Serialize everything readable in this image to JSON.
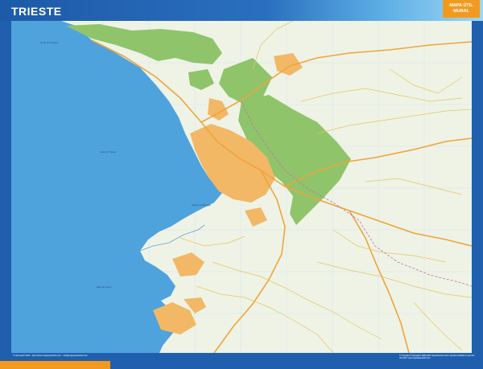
{
  "header": {
    "title": "TRIESTE",
    "badge_line1": "MAPA ÚTIL",
    "badge_line2": "MURAL"
  },
  "map": {
    "sea_labels": [
      "Golfo di Panzano",
      "Golfo di Trieste",
      "Vallone di Muggia",
      "Baia di Pirano"
    ],
    "colors": {
      "sea": "#4fa3dc",
      "land": "#eef3e6",
      "forest": "#8fc46b",
      "urban": "#f2b866",
      "road_major": "#f0a43a",
      "road_minor": "#e6c65a",
      "border": "#c06fa8",
      "frame": "#1f5fae",
      "accent": "#f39a1e"
    }
  },
  "footer": {
    "left_text": "© Netmaps® 2024 · http://www.mapasparatodo.com · info@mapasparatodo.com",
    "right_text": "© Copyright ® Netmaps® 1980-2024. Reproducción total o parcial prohibida sin permiso del editor. www.mapasparatodo.com"
  }
}
